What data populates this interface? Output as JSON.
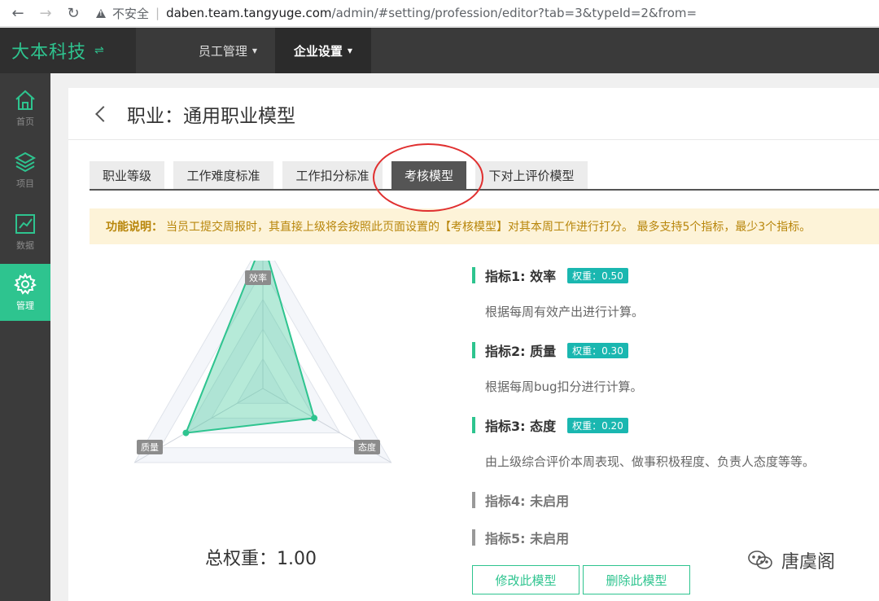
{
  "browser": {
    "insecure_label": "不安全",
    "url_host": "daben.team.tangyuge.com",
    "url_path": "/admin/#setting/profession/editor?tab=3&typeId=2&from="
  },
  "brand": {
    "name": "大本科技",
    "switch_glyph": "⇌"
  },
  "top_menu": [
    {
      "label": "员工管理",
      "active": false
    },
    {
      "label": "企业设置",
      "active": true
    }
  ],
  "sidebar": [
    {
      "label": "首页",
      "icon": "home-icon"
    },
    {
      "label": "项目",
      "icon": "layers-icon"
    },
    {
      "label": "数据",
      "icon": "chart-icon"
    },
    {
      "label": "管理",
      "icon": "gear-icon",
      "active": true
    }
  ],
  "page": {
    "title": "职业：通用职业模型"
  },
  "tabs": [
    "职业等级",
    "工作难度标准",
    "工作扣分标准",
    "考核模型",
    "下对上评价模型"
  ],
  "active_tab": "考核模型",
  "notice": {
    "label": "功能说明：",
    "text": "当员工提交周报时，其直接上级将会按照此页面设置的【考核模型】对其本周工作进行打分。 最多支持5个指标，最少3个指标。"
  },
  "radar": {
    "axes": [
      "效率",
      "态度",
      "质量"
    ],
    "values": [
      0.5,
      0.2,
      0.3
    ],
    "max": 0.5,
    "color": "#2ec48f"
  },
  "total_weight": "总权重：1.00",
  "indicators": [
    {
      "title": "指标1: 效率",
      "weight": "权重：0.50",
      "desc": "根据每周有效产出进行计算。",
      "enabled": true
    },
    {
      "title": "指标2: 质量",
      "weight": "权重：0.30",
      "desc": "根据每周bug扣分进行计算。",
      "enabled": true
    },
    {
      "title": "指标3: 态度",
      "weight": "权重：0.20",
      "desc": "由上级综合评价本周表现、做事积极程度、负责人态度等等。",
      "enabled": true
    },
    {
      "title": "指标4: 未启用",
      "enabled": false
    },
    {
      "title": "指标5: 未启用",
      "enabled": false
    }
  ],
  "buttons": {
    "edit": "修改此模型",
    "delete": "删除此模型"
  },
  "watermark": "唐虞阁"
}
